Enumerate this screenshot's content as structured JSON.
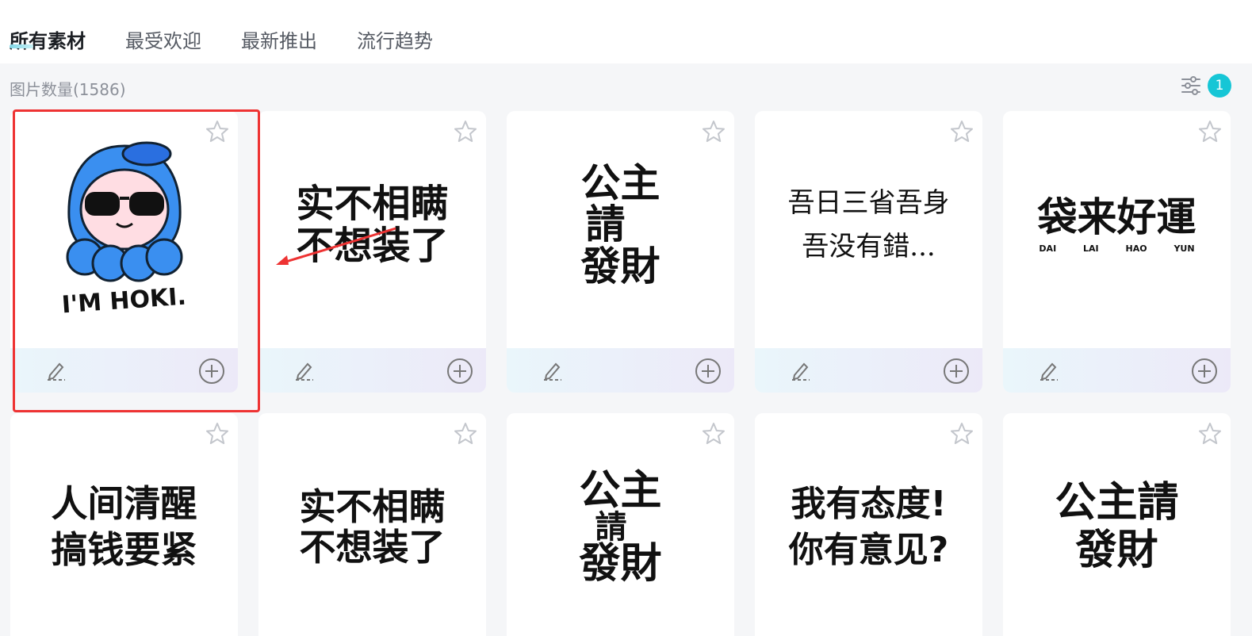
{
  "tabs": [
    {
      "label": "所有素材"
    },
    {
      "label": "最受欢迎"
    },
    {
      "label": "最新推出"
    },
    {
      "label": "流行趋势"
    }
  ],
  "toolbar": {
    "count_label": "图片数量(1586)",
    "filter_badge": "1"
  },
  "cards": [
    {
      "art": "I'M HOKI."
    },
    {
      "art_line1": "实不相瞒",
      "art_line2": "不想装了"
    },
    {
      "art_line1": "公主",
      "art_line2": "請",
      "art_line3": "發財"
    },
    {
      "art_line1": "吾日三省吾身",
      "art_line2": "吾没有錯..."
    },
    {
      "art": "袋来好運",
      "pinyin": [
        "DAI",
        "LAI",
        "HAO",
        "YUN"
      ]
    },
    {
      "art_line1": "人间清醒",
      "art_line2": "搞钱要紧"
    },
    {
      "art_line1": "实不相瞒",
      "art_line2": "不想装了"
    },
    {
      "art_line1": "公主",
      "art_line2": "請",
      "art_line3": "發財"
    },
    {
      "art_line1": "我有态度!",
      "art_line2": "你有意见?"
    },
    {
      "art_line1": "公主請",
      "art_line2": "發財"
    }
  ],
  "colors": {
    "accent": "#16c6d6",
    "highlight": "#e33333"
  }
}
